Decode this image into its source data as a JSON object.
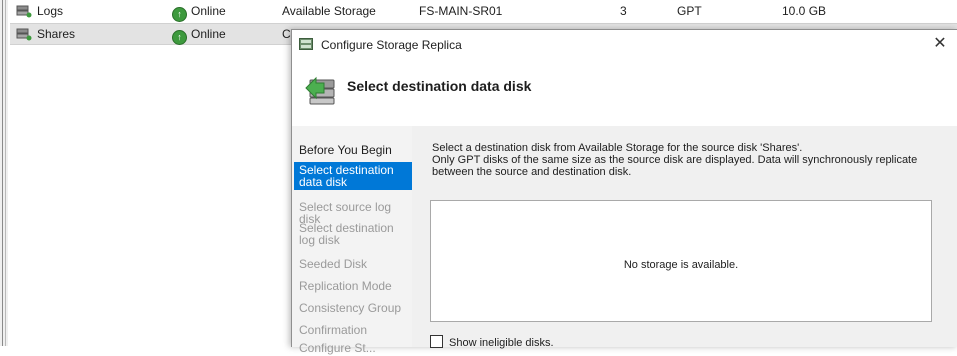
{
  "disk_rows": [
    {
      "name": "Logs",
      "status": "Online",
      "group": "Available Storage",
      "owner": "FS-MAIN-SR01",
      "disk_number": "3",
      "partition": "GPT",
      "capacity": "10.0 GB"
    },
    {
      "name": "Shares",
      "status": "Online",
      "group": "Cl",
      "owner": "",
      "disk_number": "",
      "partition": "",
      "capacity": ""
    }
  ],
  "dialog": {
    "title": "Configure Storage Replica",
    "close_label": "✕",
    "page_title": "Select destination data disk",
    "nav": [
      {
        "label": "Before You Begin",
        "state": "done"
      },
      {
        "label": "Select destination data disk",
        "state": "active"
      },
      {
        "label": "Select source log disk",
        "state": "pending"
      },
      {
        "label": "Select destination log disk",
        "state": "pending"
      },
      {
        "label": "Seeded Disk",
        "state": "pending"
      },
      {
        "label": "Replication Mode",
        "state": "pending"
      },
      {
        "label": "Consistency Group",
        "state": "pending"
      },
      {
        "label": "Confirmation",
        "state": "pending"
      },
      {
        "label": "Configure St...",
        "state": "pending"
      }
    ],
    "description_line1": "Select a destination disk from Available Storage for the source disk 'Shares'.",
    "description_line2": "Only GPT disks of the same size as the source disk are displayed. Data will synchronously replicate between the source and destination disk.",
    "empty_message": "No storage is available.",
    "show_ineligible_label": "Show ineligible disks."
  },
  "colors": {
    "accent": "#0078d7",
    "online": "#3e9a3e"
  }
}
